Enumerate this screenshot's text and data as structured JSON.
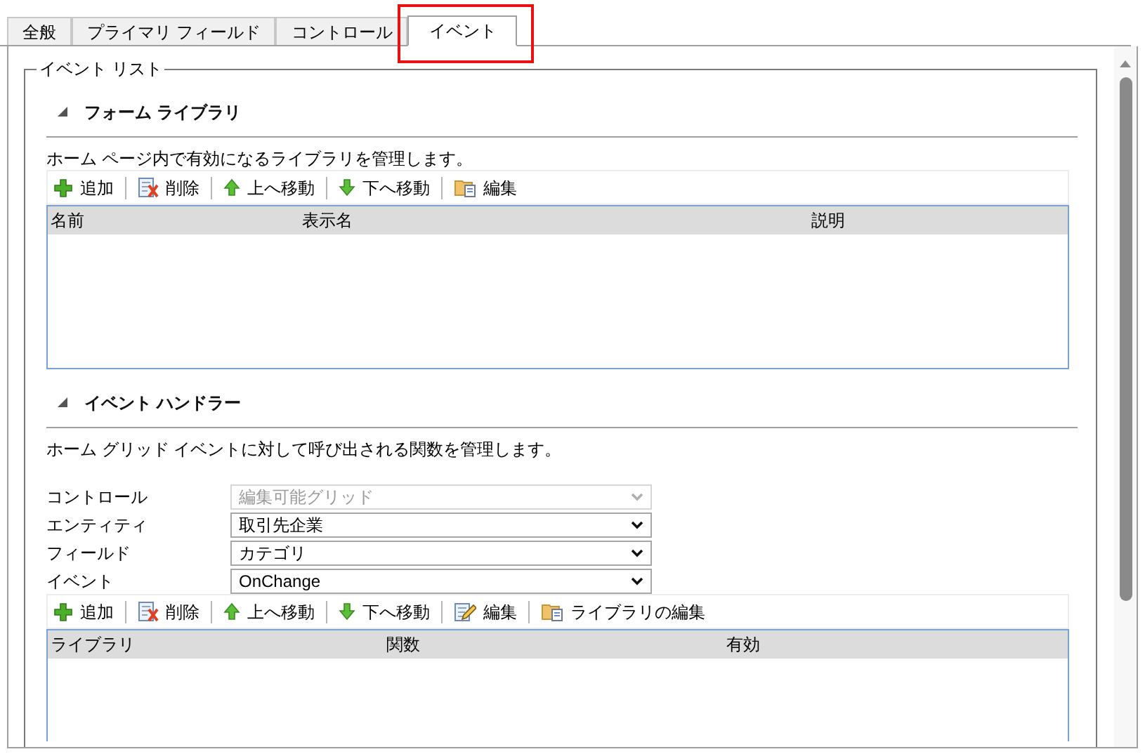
{
  "tabs": [
    {
      "label": "全般",
      "selected": false,
      "highlighted": false
    },
    {
      "label": "プライマリ フィールド",
      "selected": false,
      "highlighted": false
    },
    {
      "label": "コントロール",
      "selected": false,
      "highlighted": false
    },
    {
      "label": "イベント",
      "selected": true,
      "highlighted": true
    }
  ],
  "event_list": {
    "legend": "イベント リスト",
    "sections": [
      {
        "title": "フォーム ライブラリ",
        "expanded": true,
        "description": "ホーム ページ内で有効になるライブラリを管理します。",
        "toolbar": [
          {
            "kind": "add",
            "label": "追加"
          },
          {
            "kind": "delete",
            "label": "削除"
          },
          {
            "kind": "up",
            "label": "上へ移動"
          },
          {
            "kind": "down",
            "label": "下へ移動"
          },
          {
            "kind": "library",
            "label": "編集"
          }
        ],
        "grid": {
          "columns": [
            "名前",
            "表示名",
            "説明"
          ]
        }
      },
      {
        "title": "イベント ハンドラー",
        "expanded": true,
        "description": "ホーム グリッド イベントに対して呼び出される関数を管理します。",
        "fields": [
          {
            "label": "コントロール",
            "value": "編集可能グリッド",
            "disabled": true
          },
          {
            "label": "エンティティ",
            "value": "取引先企業",
            "disabled": false
          },
          {
            "label": "フィールド",
            "value": "カテゴリ",
            "disabled": false
          },
          {
            "label": "イベント",
            "value": "OnChange",
            "disabled": false
          }
        ],
        "toolbar": [
          {
            "kind": "add",
            "label": "追加"
          },
          {
            "kind": "delete",
            "label": "削除"
          },
          {
            "kind": "up",
            "label": "上へ移動"
          },
          {
            "kind": "down",
            "label": "下へ移動"
          },
          {
            "kind": "pencil",
            "label": "編集"
          },
          {
            "kind": "library",
            "label": "ライブラリの編集"
          }
        ],
        "grid": {
          "columns": [
            "ライブラリ",
            "関数",
            "有効"
          ]
        }
      }
    ]
  }
}
